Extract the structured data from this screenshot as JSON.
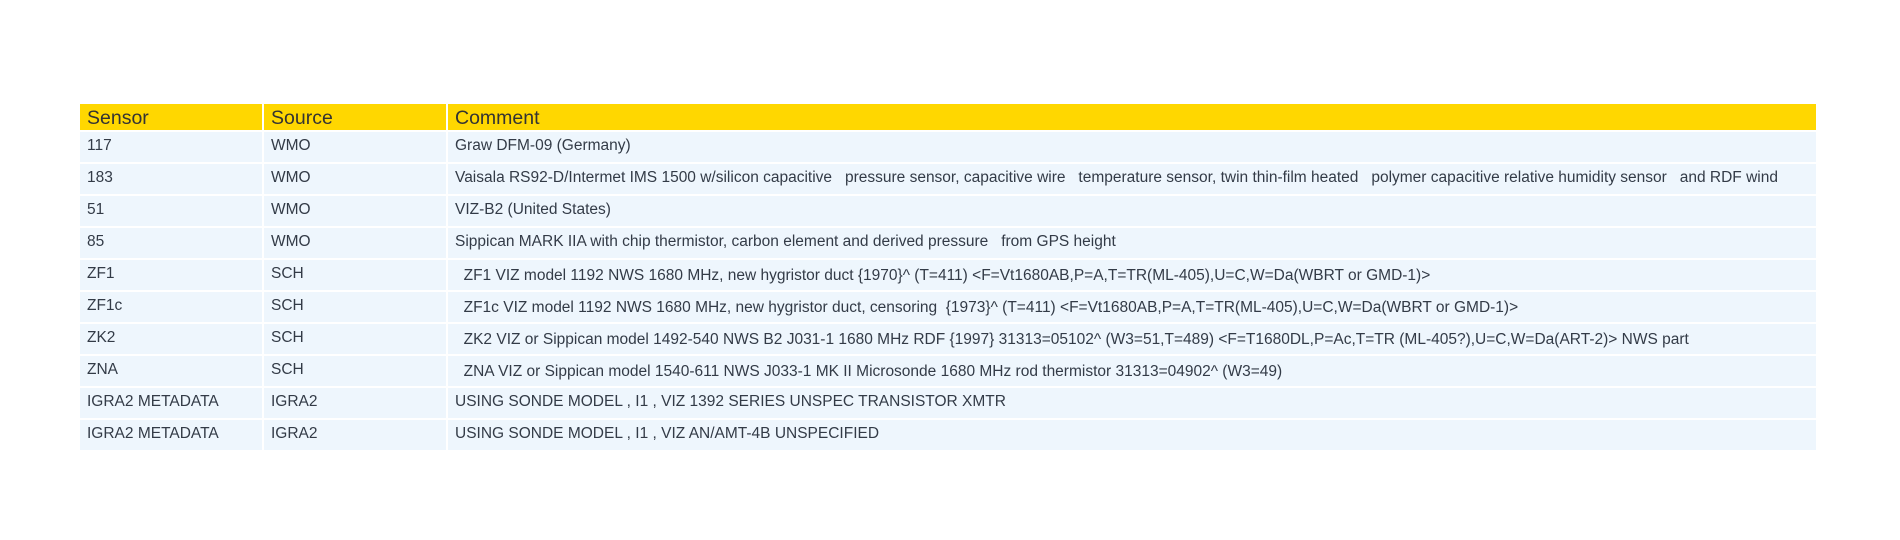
{
  "table": {
    "headers": [
      "Sensor",
      "Source",
      "Comment"
    ],
    "rows": [
      {
        "sensor": "117",
        "source": "WMO",
        "comment": "Graw DFM-09 (Germany)"
      },
      {
        "sensor": "183",
        "source": "WMO",
        "comment": "Vaisala RS92-D/Intermet IMS 1500 w/silicon capacitive   pressure sensor, capacitive wire   temperature sensor, twin thin-film heated   polymer capacitive relative humidity sensor   and RDF wind"
      },
      {
        "sensor": "51",
        "source": "WMO",
        "comment": "VIZ-B2 (United States)"
      },
      {
        "sensor": "85",
        "source": "WMO",
        "comment": "Sippican MARK IIA with chip thermistor, carbon element and derived pressure   from GPS height"
      },
      {
        "sensor": "ZF1",
        "source": "SCH",
        "comment": "  ZF1 VIZ model 1192 NWS 1680 MHz, new hygristor duct {1970}^ (T=411) <F=Vt1680AB,P=A,T=TR(ML-405),U=C,W=Da(WBRT or GMD-1)>"
      },
      {
        "sensor": "ZF1c",
        "source": "SCH",
        "comment": "  ZF1c VIZ model 1192 NWS 1680 MHz, new hygristor duct, censoring  {1973}^ (T=411) <F=Vt1680AB,P=A,T=TR(ML-405),U=C,W=Da(WBRT or GMD-1)>"
      },
      {
        "sensor": "ZK2",
        "source": "SCH",
        "comment": "  ZK2 VIZ or Sippican model 1492-540 NWS B2 J031-1 1680 MHz RDF {1997} 31313=05102^ (W3=51,T=489) <F=T1680DL,P=Ac,T=TR (ML-405?),U=C,W=Da(ART-2)> NWS part"
      },
      {
        "sensor": "ZNA",
        "source": "SCH",
        "comment": "  ZNA VIZ or Sippican model 1540-611 NWS J033-1 MK II Microsonde 1680 MHz rod thermistor 31313=04902^ (W3=49)"
      },
      {
        "sensor": "IGRA2 METADATA",
        "source": "IGRA2",
        "comment": "USING SONDE MODEL , I1 , VIZ 1392 SERIES UNSPEC TRANSISTOR XMTR"
      },
      {
        "sensor": "IGRA2 METADATA",
        "source": "IGRA2",
        "comment": "USING SONDE MODEL , I1 , VIZ AN/AMT-4B UNSPECIFIED"
      }
    ]
  },
  "colors": {
    "header_bg": "#ffd700",
    "row_bg": "#eef6fd",
    "text": "#333b47"
  }
}
